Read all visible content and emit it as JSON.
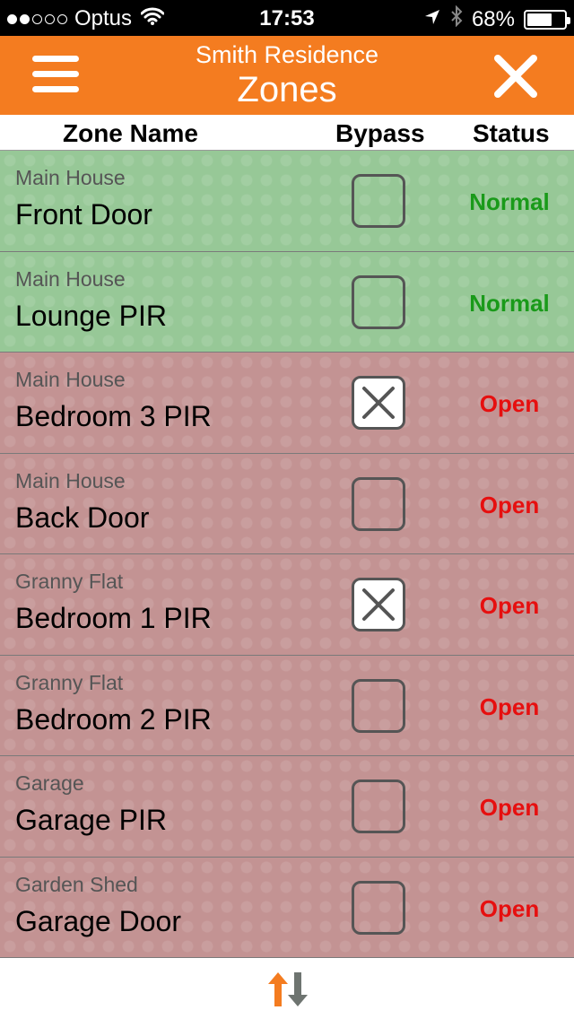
{
  "status_bar": {
    "carrier": "Optus",
    "signal_bars_filled": 2,
    "signal_bars_total": 5,
    "time": "17:53",
    "battery_percent_label": "68%",
    "battery_level": 0.68,
    "icons": [
      "wifi-icon",
      "location-arrow-icon",
      "bluetooth-icon",
      "battery-icon"
    ]
  },
  "header": {
    "subtitle": "Smith Residence",
    "title": "Zones",
    "background_color": "#f47c20",
    "menu_icon": "hamburger-menu-icon",
    "close_icon": "close-icon"
  },
  "columns": {
    "name": "Zone Name",
    "bypass": "Bypass",
    "status": "Status"
  },
  "colors": {
    "normal_row": "#97c897",
    "open_row": "#c39393",
    "normal_text": "#1a9a1a",
    "open_text": "#e60f0f"
  },
  "zones": [
    {
      "area": "Main House",
      "name": "Front Door",
      "bypass": false,
      "status": "Normal",
      "state": "normal"
    },
    {
      "area": "Main House",
      "name": "Lounge PIR",
      "bypass": false,
      "status": "Normal",
      "state": "normal"
    },
    {
      "area": "Main House",
      "name": "Bedroom 3 PIR",
      "bypass": true,
      "status": "Open",
      "state": "open"
    },
    {
      "area": "Main House",
      "name": "Back Door",
      "bypass": false,
      "status": "Open",
      "state": "open"
    },
    {
      "area": "Granny Flat",
      "name": "Bedroom 1 PIR",
      "bypass": true,
      "status": "Open",
      "state": "open"
    },
    {
      "area": "Granny Flat",
      "name": "Bedroom 2 PIR",
      "bypass": false,
      "status": "Open",
      "state": "open"
    },
    {
      "area": "Garage",
      "name": "Garage PIR",
      "bypass": false,
      "status": "Open",
      "state": "open"
    },
    {
      "area": "Garden Shed",
      "name": "Garage Door",
      "bypass": false,
      "status": "Open",
      "state": "open"
    }
  ],
  "bottom": {
    "sort_icon": "sort-arrows-icon"
  }
}
